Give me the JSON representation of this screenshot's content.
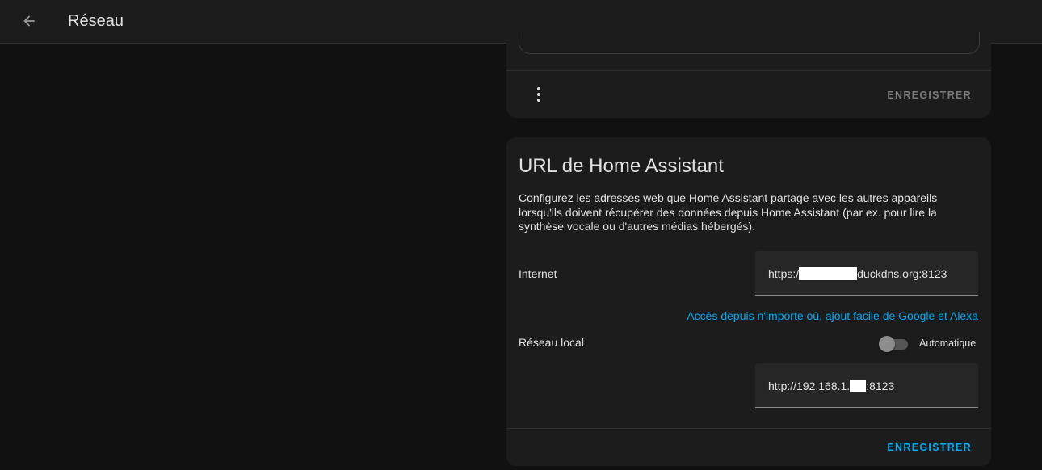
{
  "header": {
    "back_icon": "arrow-left-icon",
    "title": "Réseau"
  },
  "top_card": {
    "menu_icon": "dots-vertical-icon",
    "save_label": "ENREGISTRER",
    "save_color": "#7b7b7b"
  },
  "url_card": {
    "title": "URL de Home Assistant",
    "description": "Configurez les adresses web que Home Assistant partage avec les autres appareils lorsqu'ils doivent récupérer des données depuis Home Assistant (par ex. pour lire la synthèse vocale ou d'autres médias hébergés).",
    "internet": {
      "label": "Internet",
      "value_prefix": "https:/",
      "value_suffix": "duckdns.org:8123"
    },
    "cloud_link": "Accès depuis n'importe où, ajout facile de Google et Alexa",
    "local": {
      "label": "Réseau local",
      "toggle_label": "Automatique",
      "toggle_on": false,
      "value_prefix": "http://192.168.1.",
      "value_suffix": ":8123"
    },
    "save_label": "ENREGISTRER",
    "save_color": "#03a9f4"
  },
  "colors": {
    "background": "#111111",
    "card": "#1c1c1c",
    "accent": "#03a9f4"
  }
}
